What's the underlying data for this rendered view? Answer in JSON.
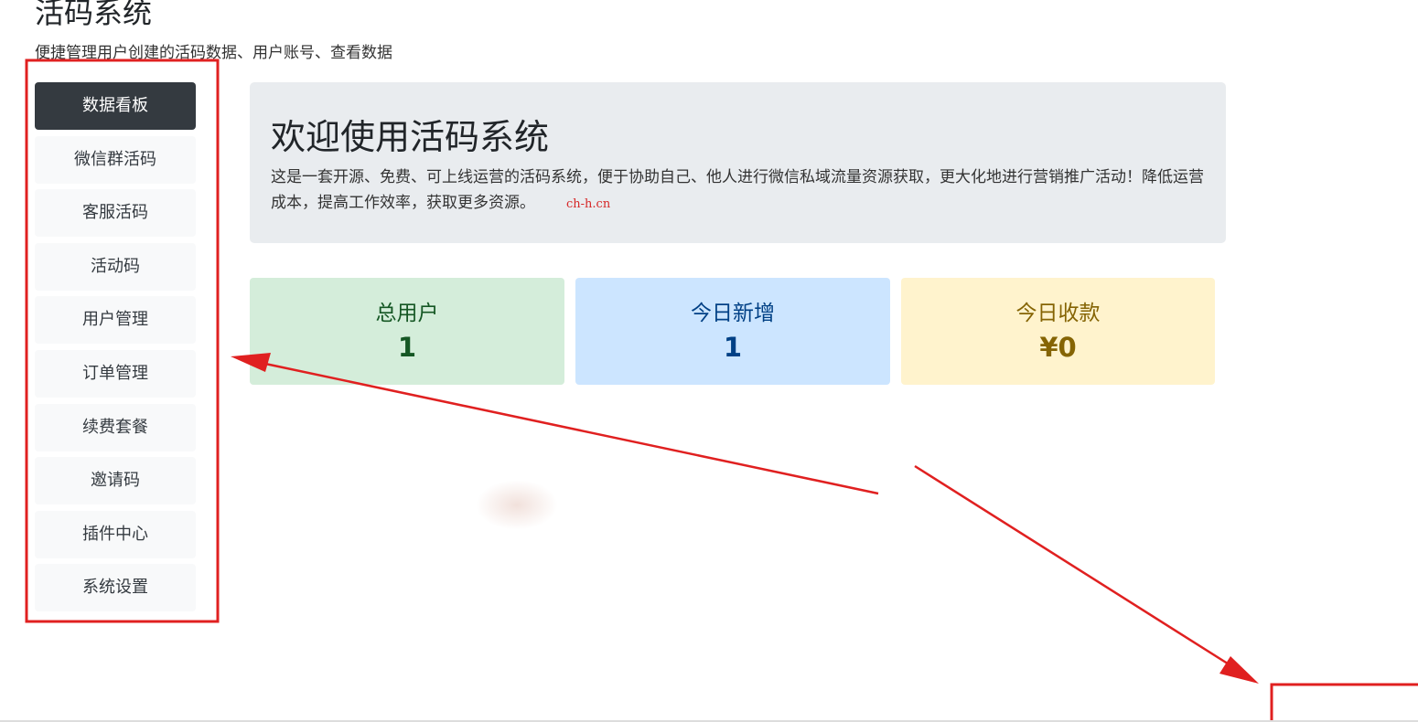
{
  "header": {
    "title": "活码系统",
    "subtitle": "便捷管理用户创建的活码数据、用户账号、查看数据"
  },
  "sidebar": {
    "items": [
      {
        "label": "数据看板",
        "active": true
      },
      {
        "label": "微信群活码"
      },
      {
        "label": "客服活码"
      },
      {
        "label": "活动码"
      },
      {
        "label": "用户管理"
      },
      {
        "label": "订单管理"
      },
      {
        "label": "续费套餐"
      },
      {
        "label": "邀请码"
      },
      {
        "label": "插件中心"
      },
      {
        "label": "系统设置"
      }
    ]
  },
  "main": {
    "welcome": {
      "title": "欢迎使用活码系统",
      "description": "这是一套开源、免费、可上线运营的活码系统，便于协助自己、他人进行微信私域流量资源获取，更大化地进行营销推广活动！降低运营成本，提高工作效率，获取更多资源。",
      "watermark": "ch-h.cn"
    },
    "stats": [
      {
        "label": "总用户",
        "value": "1"
      },
      {
        "label": "今日新增",
        "value": "1"
      },
      {
        "label": "今日收款",
        "value": "¥0"
      }
    ]
  },
  "colors": {
    "annotation": "#e02020",
    "nav_active_bg": "#343a40",
    "nav_bg": "#f8f9fa",
    "jumbotron_bg": "#e9ecef",
    "stat_green_bg": "#d4edda",
    "stat_blue_bg": "#cce5ff",
    "stat_yellow_bg": "#fff3cd"
  }
}
